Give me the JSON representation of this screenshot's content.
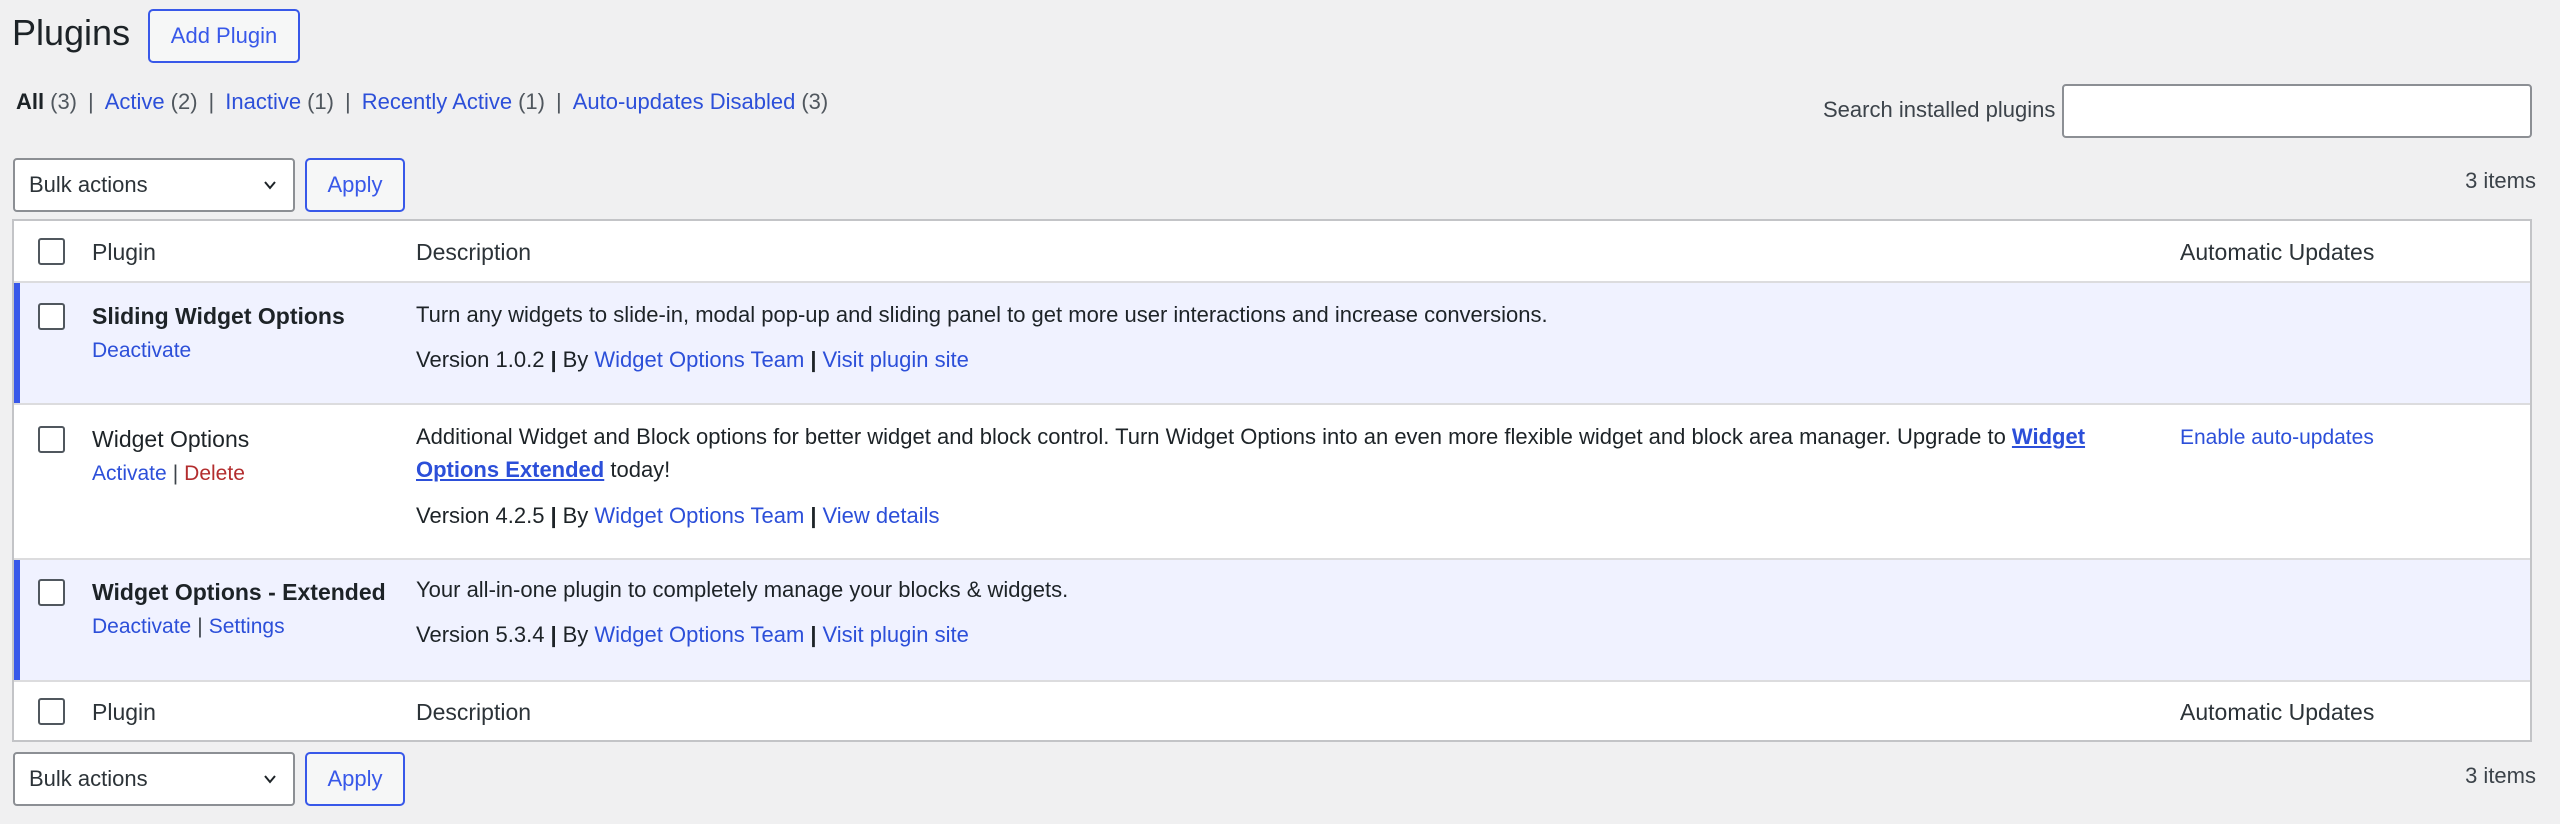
{
  "header": {
    "title": "Plugins",
    "add_button": "Add Plugin"
  },
  "filters": [
    {
      "label": "All",
      "count": "(3)"
    },
    {
      "label": "Active",
      "count": "(2)"
    },
    {
      "label": "Inactive",
      "count": "(1)"
    },
    {
      "label": "Recently Active",
      "count": "(1)"
    },
    {
      "label": "Auto-updates Disabled",
      "count": "(3)"
    }
  ],
  "search": {
    "label": "Search installed plugins",
    "value": "",
    "placeholder": ""
  },
  "bulk": {
    "select_value": "Bulk actions",
    "apply_label": "Apply",
    "items_count": "3 items"
  },
  "table": {
    "columns": [
      "Plugin",
      "Description",
      "Automatic Updates"
    ],
    "rows": [
      {
        "name": "Sliding Widget Options",
        "actions": [
          "Deactivate"
        ],
        "description": "Turn any widgets to slide-in, modal pop-up and sliding panel to get more user interactions and increase conversions.",
        "version": "Version 1.0.2",
        "by": "By",
        "author": "Widget Options Team",
        "link": "Visit plugin site",
        "auto_update": ""
      },
      {
        "name": "Widget Options",
        "actions": [
          "Activate",
          "Delete"
        ],
        "description_pre": "Additional Widget and Block options for better widget and block control. Turn Widget Options into an even more flexible widget and block area manager. Upgrade to ",
        "description_link": "Widget Options Extended",
        "description_post": " today!",
        "version": "Version 4.2.5",
        "by": "By",
        "author": "Widget Options Team",
        "link": "View details",
        "auto_update": "Enable auto-updates"
      },
      {
        "name": "Widget Options - Extended",
        "actions": [
          "Deactivate",
          "Settings"
        ],
        "description": "Your all-in-one plugin to completely manage your blocks & widgets.",
        "version": "Version 5.3.4",
        "by": "By",
        "author": "Widget Options Team",
        "link": "Visit plugin site",
        "auto_update": ""
      }
    ]
  },
  "colors": {
    "accent": "#3858e9",
    "link": "#2c4fd9",
    "delete": "#b32d2e",
    "active_row_bg": "#f0f2ff",
    "page_bg": "#f0f0f1"
  },
  "icons": {
    "select_chevron": "chevron-down-icon"
  }
}
